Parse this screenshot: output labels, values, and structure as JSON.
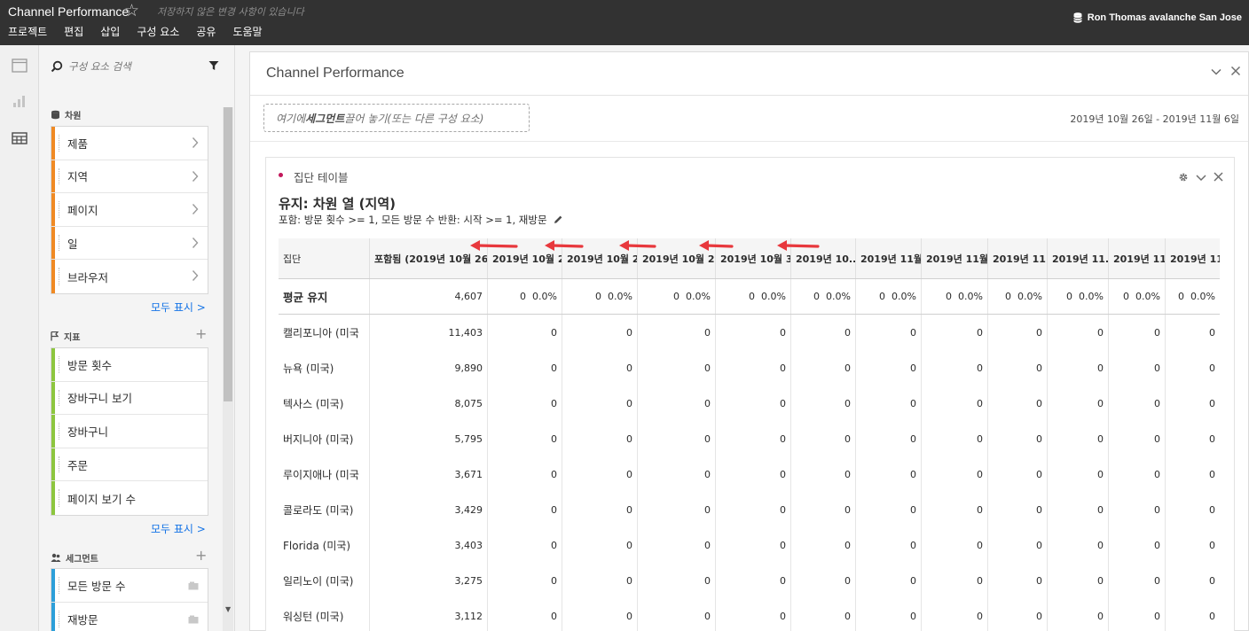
{
  "topbar": {
    "title": "Channel Performance",
    "unsaved": "저장하지 않은 변경 사항이 있습니다",
    "menu": [
      "프로젝트",
      "편집",
      "삽입",
      "구성 요소",
      "공유",
      "도움말"
    ],
    "user": "Ron Thomas avalanche San Jose"
  },
  "rail": {
    "icons": [
      "panel-icon",
      "visualization-icon",
      "components-icon"
    ]
  },
  "components": {
    "search_placeholder": "구성 요소 검색",
    "dimensions": {
      "label": "차원",
      "items": [
        "제품",
        "지역",
        "페이지",
        "일",
        "브라우저"
      ],
      "color": "#f08a24"
    },
    "metrics": {
      "label": "지표",
      "items": [
        "방문 횟수",
        "장바구니 보기",
        "장바구니",
        "주문",
        "페이지 보기 수"
      ],
      "color": "#8dc63f"
    },
    "segments": {
      "label": "세그먼트",
      "items": [
        "모든 방문 수",
        "재방문"
      ],
      "color": "#2d9fd9"
    },
    "show_all": "모두 표시 >"
  },
  "panel": {
    "title": "Channel Performance",
    "drop_prefix": "여기에 ",
    "drop_bold": "세그먼트",
    "drop_suffix": " 끌어 놓기(또는 다른 구성 요소)",
    "date_range": "2019년 10월 26일 - 2019년 11월 6일"
  },
  "visualization": {
    "title": "집단 테이블",
    "retention_title": "유지: 차원 열 (지역)",
    "criteria": "포함: 방문 횟수 >= 1,  모든 방문 수  반환: 시작 >= 1,  재방문",
    "columns": [
      "집단",
      "포함됨 (2019년 10월 26...",
      "2019년 10월 2...",
      "2019년 10월 2...",
      "2019년 10월 2...",
      "2019년 10월 3...",
      "2019년 10...",
      "2019년 11월...",
      "2019년 11월...",
      "2019년 11...",
      "2019년 11...",
      "2019년 11...",
      "2019년 11..."
    ],
    "average": {
      "label": "평균 유지",
      "included": "4,607",
      "cells": [
        [
          "0",
          "0.0%"
        ],
        [
          "0",
          "0.0%"
        ],
        [
          "0",
          "0.0%"
        ],
        [
          "0",
          "0.0%"
        ],
        [
          "0",
          "0.0%"
        ],
        [
          "0",
          "0.0%"
        ],
        [
          "0",
          "0.0%"
        ],
        [
          "0",
          "0.0%"
        ],
        [
          "0",
          "0.0%"
        ],
        [
          "0",
          "0.0%"
        ],
        [
          "0",
          "0.0%"
        ]
      ]
    },
    "rows": [
      {
        "label": "캘리포니아 (미국",
        "included": "11,403",
        "values": [
          "0",
          "0",
          "0",
          "0",
          "0",
          "0",
          "0",
          "0",
          "0",
          "0",
          "0"
        ]
      },
      {
        "label": "뉴욕 (미국)",
        "included": "9,890",
        "values": [
          "0",
          "0",
          "0",
          "0",
          "0",
          "0",
          "0",
          "0",
          "0",
          "0",
          "0"
        ]
      },
      {
        "label": "텍사스 (미국)",
        "included": "8,075",
        "values": [
          "0",
          "0",
          "0",
          "0",
          "0",
          "0",
          "0",
          "0",
          "0",
          "0",
          "0"
        ]
      },
      {
        "label": "버지니아 (미국)",
        "included": "5,795",
        "values": [
          "0",
          "0",
          "0",
          "0",
          "0",
          "0",
          "0",
          "0",
          "0",
          "0",
          "0"
        ]
      },
      {
        "label": "루이지애나 (미국",
        "included": "3,671",
        "values": [
          "0",
          "0",
          "0",
          "0",
          "0",
          "0",
          "0",
          "0",
          "0",
          "0",
          "0"
        ]
      },
      {
        "label": "콜로라도 (미국)",
        "included": "3,429",
        "values": [
          "0",
          "0",
          "0",
          "0",
          "0",
          "0",
          "0",
          "0",
          "0",
          "0",
          "0"
        ]
      },
      {
        "label": "Florida (미국)",
        "included": "3,403",
        "values": [
          "0",
          "0",
          "0",
          "0",
          "0",
          "0",
          "0",
          "0",
          "0",
          "0",
          "0"
        ]
      },
      {
        "label": "일리노이 (미국)",
        "included": "3,275",
        "values": [
          "0",
          "0",
          "0",
          "0",
          "0",
          "0",
          "0",
          "0",
          "0",
          "0",
          "0"
        ]
      },
      {
        "label": "워싱턴 (미국)",
        "included": "3,112",
        "values": [
          "0",
          "0",
          "0",
          "0",
          "0",
          "0",
          "0",
          "0",
          "0",
          "0",
          "0"
        ]
      }
    ],
    "annotation_color": "#e8383d"
  }
}
